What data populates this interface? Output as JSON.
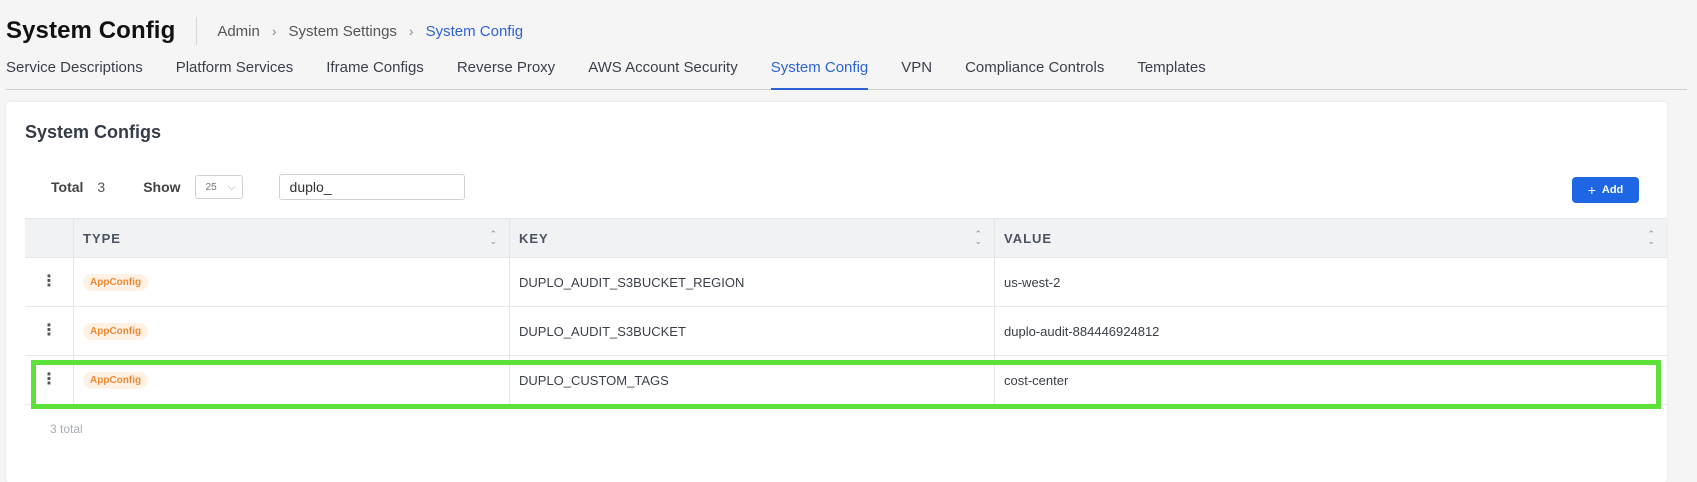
{
  "header": {
    "title": "System Config",
    "breadcrumb": [
      "Admin",
      "System Settings",
      "System Config"
    ]
  },
  "tabs": [
    {
      "label": "Service Descriptions",
      "active": false
    },
    {
      "label": "Platform Services",
      "active": false
    },
    {
      "label": "Iframe Configs",
      "active": false
    },
    {
      "label": "Reverse Proxy",
      "active": false
    },
    {
      "label": "AWS Account Security",
      "active": false
    },
    {
      "label": "System Config",
      "active": true
    },
    {
      "label": "VPN",
      "active": false
    },
    {
      "label": "Compliance Controls",
      "active": false
    },
    {
      "label": "Templates",
      "active": false
    }
  ],
  "card": {
    "title": "System Configs",
    "total_label": "Total",
    "total_value": "3",
    "show_label": "Show",
    "page_size": "25",
    "search_value": "duplo_",
    "add_label": "Add",
    "footer_total": "3 total"
  },
  "table": {
    "columns": [
      "TYPE",
      "KEY",
      "VALUE"
    ],
    "rows": [
      {
        "type": "AppConfig",
        "key": "DUPLO_AUDIT_S3BUCKET_REGION",
        "value": "us-west-2"
      },
      {
        "type": "AppConfig",
        "key": "DUPLO_AUDIT_S3BUCKET",
        "value": "duplo-audit-884446924812"
      },
      {
        "type": "AppConfig",
        "key": "DUPLO_CUSTOM_TAGS",
        "value": "cost-center"
      }
    ]
  },
  "colors": {
    "accent": "#2e63d6",
    "button": "#1f66e5",
    "badge_text": "#f08a32",
    "badge_bg": "#fff1e4",
    "highlight": "#5ce23a"
  },
  "icons": [
    "chevron-right-icon",
    "chevron-down-icon",
    "plus-icon",
    "sort-icon",
    "kebab-menu-icon"
  ]
}
